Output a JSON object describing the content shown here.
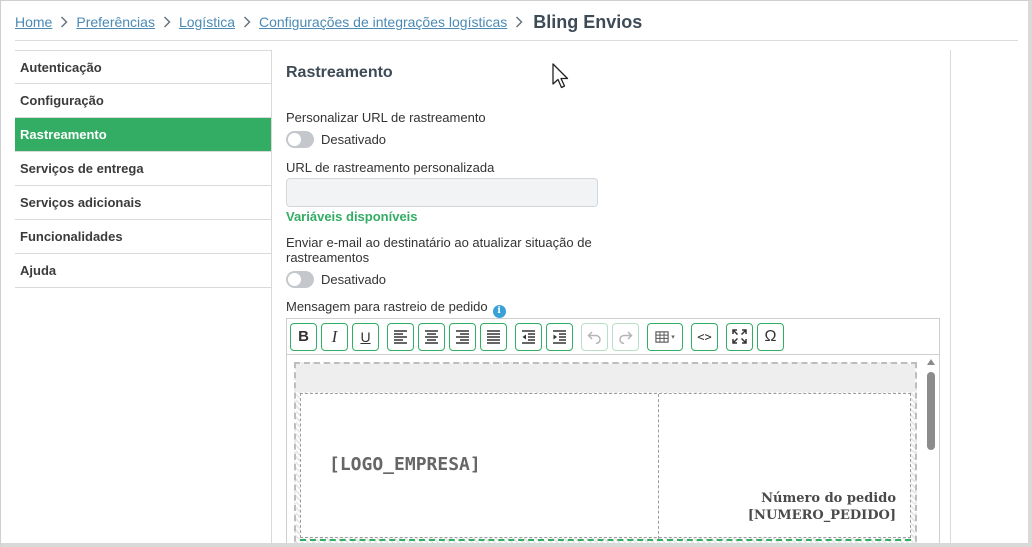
{
  "breadcrumb": {
    "items": [
      "Home",
      "Preferências",
      "Logística",
      "Configurações de integrações logísticas"
    ],
    "current": "Bling Envios"
  },
  "sidebar": {
    "items": [
      {
        "label": "Autenticação",
        "active": false
      },
      {
        "label": "Configuração",
        "active": false
      },
      {
        "label": "Rastreamento",
        "active": true
      },
      {
        "label": "Serviços de entrega",
        "active": false
      },
      {
        "label": "Serviços adicionais",
        "active": false
      },
      {
        "label": "Funcionalidades",
        "active": false
      },
      {
        "label": "Ajuda",
        "active": false
      }
    ]
  },
  "main": {
    "section_title": "Rastreamento",
    "custom_url_label": "Personalizar URL de rastreamento",
    "custom_url_toggle": {
      "state_label": "Desativado",
      "on": false
    },
    "url_field_label": "URL de rastreamento personalizada",
    "url_field_value": "",
    "variables_link": "Variáveis disponíveis",
    "email_label": "Enviar e-mail ao destinatário ao atualizar situação de rastreamentos",
    "email_toggle": {
      "state_label": "Desativado",
      "on": false
    },
    "message_label": "Mensagem para rastreio de pedido",
    "info_icon": "info-icon"
  },
  "editor": {
    "toolbar_icons": [
      "bold-icon",
      "italic-icon",
      "underline-icon",
      "align-left-icon",
      "align-center-icon",
      "align-right-icon",
      "align-justify-icon",
      "outdent-icon",
      "indent-icon",
      "undo-icon",
      "redo-icon",
      "table-icon",
      "source-code-icon",
      "fullscreen-icon",
      "special-char-icon"
    ],
    "toolbar": {
      "bold": "B",
      "italic": "I",
      "underline": "U",
      "special_char": "Ω",
      "source": "<>"
    },
    "content": {
      "logo_tag": "[LOGO_EMPRESA]",
      "order_label": "Número do pedido",
      "order_value": "[NUMERO_PEDIDO]"
    }
  },
  "colors": {
    "accent_green": "#33ad63",
    "link_blue": "#4a8ab5",
    "title_dark": "#3d4b57",
    "toggle_off": "#c4c8cc"
  }
}
